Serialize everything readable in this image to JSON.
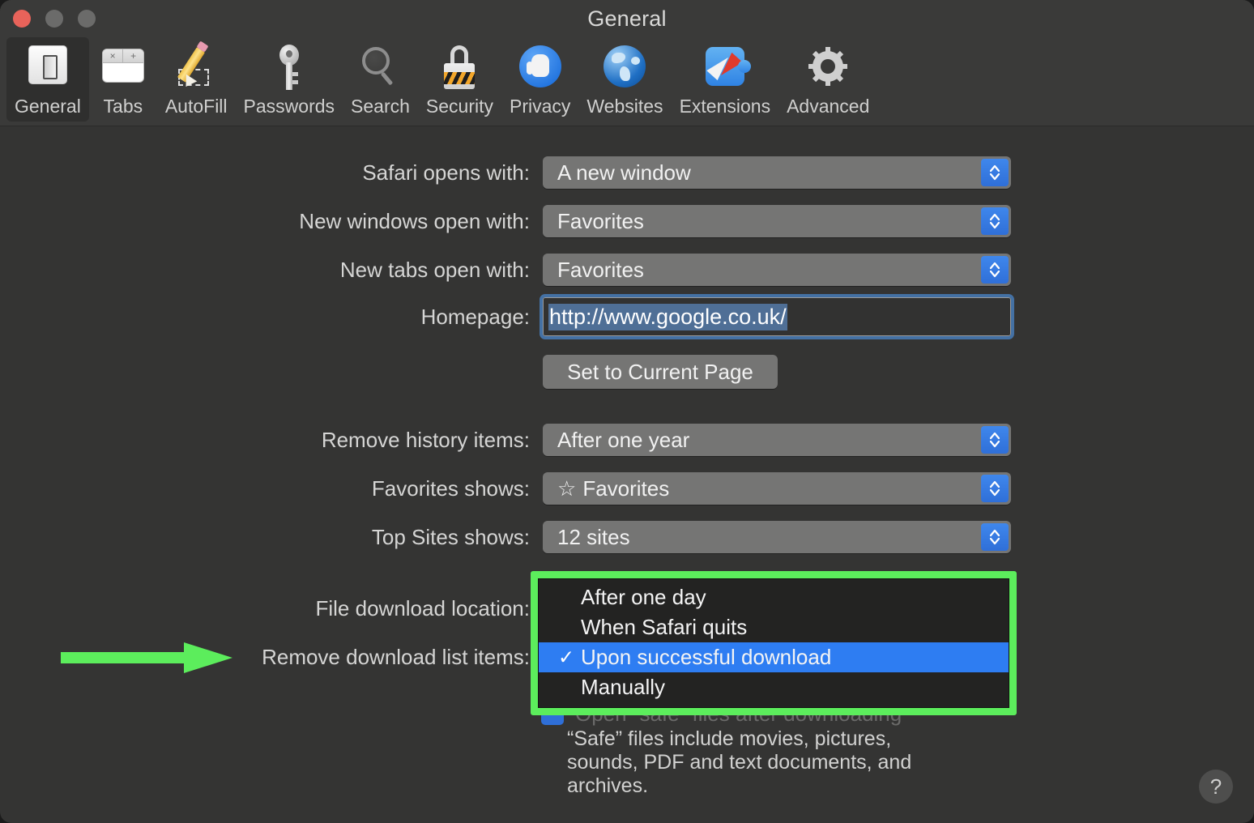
{
  "window": {
    "title": "General",
    "traffic_lights": [
      "close",
      "minimize",
      "zoom"
    ]
  },
  "toolbar": {
    "items": [
      {
        "label": "General",
        "icon": "general-icon",
        "selected": true
      },
      {
        "label": "Tabs",
        "icon": "tabs-icon",
        "selected": false
      },
      {
        "label": "AutoFill",
        "icon": "autofill-icon",
        "selected": false
      },
      {
        "label": "Passwords",
        "icon": "key-icon",
        "selected": false
      },
      {
        "label": "Search",
        "icon": "magnifier-icon",
        "selected": false
      },
      {
        "label": "Security",
        "icon": "lock-icon",
        "selected": false
      },
      {
        "label": "Privacy",
        "icon": "hand-icon",
        "selected": false
      },
      {
        "label": "Websites",
        "icon": "globe-icon",
        "selected": false
      },
      {
        "label": "Extensions",
        "icon": "puzzle-icon",
        "selected": false
      },
      {
        "label": "Advanced",
        "icon": "gear-icon",
        "selected": false
      }
    ]
  },
  "form": {
    "safari_opens_with": {
      "label": "Safari opens with:",
      "value": "A new window"
    },
    "new_windows_open": {
      "label": "New windows open with:",
      "value": "Favorites"
    },
    "new_tabs_open": {
      "label": "New tabs open with:",
      "value": "Favorites"
    },
    "homepage": {
      "label": "Homepage:",
      "value": "http://www.google.co.uk/"
    },
    "set_current_page": {
      "label": "Set to Current Page"
    },
    "remove_history": {
      "label": "Remove history items:",
      "value": "After one year"
    },
    "favorites_shows": {
      "label": "Favorites shows:",
      "value": "Favorites",
      "icon": "star-icon",
      "glyph": "☆"
    },
    "top_sites_shows": {
      "label": "Top Sites shows:",
      "value": "12 sites"
    },
    "file_download_loc": {
      "label": "File download location:"
    },
    "remove_download_list": {
      "label": "Remove download list items:"
    },
    "open_safe_files": {
      "label": "Open “safe” files after downloading"
    },
    "safe_files_note": "“Safe” files include movies, pictures, sounds, PDF and text documents, and archives."
  },
  "dropdown_menu": {
    "open": true,
    "items": [
      {
        "label": "After one day",
        "checked": false
      },
      {
        "label": "When Safari quits",
        "checked": false
      },
      {
        "label": "Upon successful download",
        "checked": true
      },
      {
        "label": "Manually",
        "checked": false
      }
    ],
    "check_glyph": "✓"
  },
  "annotation": {
    "arrow_color": "#5ced5c",
    "highlight_color": "#5ced5c",
    "points_to": "Remove download list items:"
  },
  "help_button": {
    "label": "?"
  },
  "colors": {
    "window_bg": "#343433",
    "titlebar_bg": "#3a3a39",
    "popup_bg": "#757574",
    "stepper_blue": "#2f6fd8",
    "menu_bg": "#232322",
    "menu_highlight": "#2e7df2",
    "annotation_green": "#5ced5c",
    "text_primary": "#f1f1f1",
    "text_label": "#d5d5d4"
  }
}
